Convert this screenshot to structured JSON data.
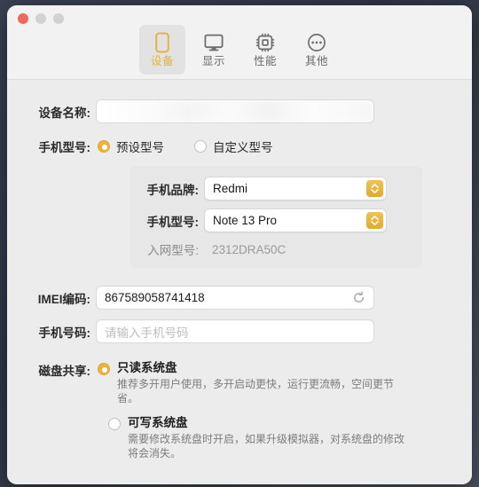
{
  "window": {
    "traffic_lights": [
      {
        "name": "close",
        "color": "#eb6a5d",
        "enabled": true
      },
      {
        "name": "minimize",
        "color": "#d2d2d2",
        "enabled": false
      },
      {
        "name": "maximize",
        "color": "#d2d2d2",
        "enabled": false
      }
    ],
    "accent_color": "#e3b23c",
    "background_color": "#ececec"
  },
  "toolbar": {
    "tabs": [
      {
        "label": "设备",
        "icon": "phone-icon",
        "active": true
      },
      {
        "label": "显示",
        "icon": "monitor-icon",
        "active": false
      },
      {
        "label": "性能",
        "icon": "cpu-chip-icon",
        "active": false
      },
      {
        "label": "其他",
        "icon": "ellipsis-circle-icon",
        "active": false
      }
    ]
  },
  "form": {
    "device_name": {
      "label": "设备名称:",
      "value": "",
      "redacted": true
    },
    "model_mode": {
      "label": "手机型号:",
      "options": [
        {
          "label": "预设型号",
          "selected": true
        },
        {
          "label": "自定义型号",
          "selected": false
        }
      ]
    },
    "brand": {
      "label": "手机品牌:",
      "value": "Redmi",
      "control": "select"
    },
    "model": {
      "label": "手机型号:",
      "value": "Note 13 Pro",
      "control": "select"
    },
    "network_model": {
      "label": "入网型号:",
      "value": "2312DRA50C",
      "readonly": true
    },
    "imei": {
      "label": "IMEI编码:",
      "value": "867589058741418",
      "refresh_icon": "refresh-icon"
    },
    "phone_number": {
      "label": "手机号码:",
      "value": "",
      "placeholder": "请输入手机号码"
    },
    "disk_sharing": {
      "label": "磁盘共享:",
      "options": [
        {
          "title": "只读系统盘",
          "description": "推荐多开用户使用，多开启动更快，运行更流畅，空间更节省。",
          "selected": true
        },
        {
          "title": "可写系统盘",
          "description": "需要修改系统盘时开启，如果升级模拟器，对系统盘的修改将会消失。",
          "selected": false
        }
      ]
    }
  }
}
